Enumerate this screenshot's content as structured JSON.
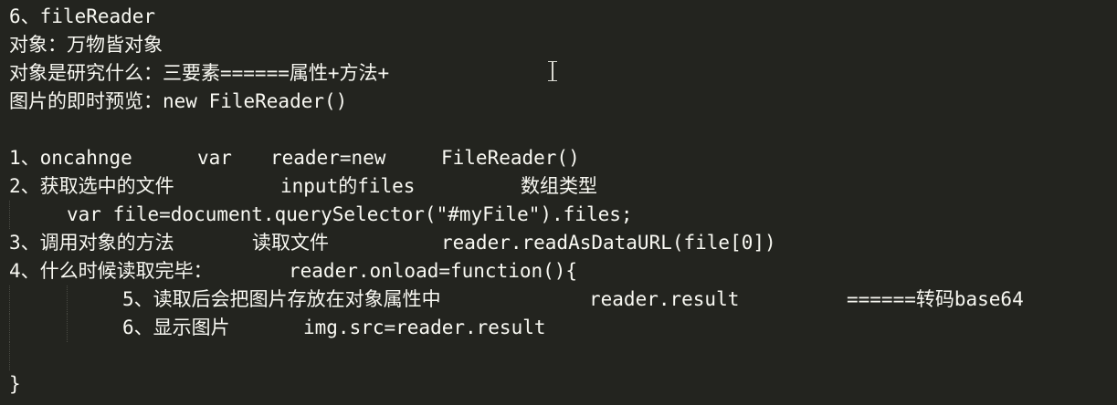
{
  "editor": {
    "lines": {
      "l1": "6、fileReader",
      "l2": "对象：万物皆对象",
      "l3": "对象是研究什么：三要素======属性+方法+",
      "l4": "图片的即时预览：new FileReader()",
      "l5": "",
      "l6a": "1、oncahnge",
      "l6b": "var",
      "l6c": "reader=new",
      "l6d": "FileReader()",
      "l7a": "2、获取选中的文件",
      "l7b": "input的files",
      "l7c": "数组类型",
      "l8": "var file=document.querySelector(\"#myFile\").files;",
      "l9a": "3、调用对象的方法",
      "l9b": "读取文件",
      "l9c": "reader.readAsDataURL(file[0])",
      "l10a": "4、什么时候读取完毕：",
      "l10b": "reader.onload=function(){",
      "l11a": "5、读取后会把图片存放在对象属性中",
      "l11b": "reader.result",
      "l11c": "======转码base64",
      "l12a": "6、显示图片",
      "l12b": "img.src=reader.result",
      "l13": "",
      "l14": "}"
    },
    "colors": {
      "background": "#23241f",
      "text": "#f8f8f2"
    },
    "cursor_icon": "text-cursor-ibeam-icon"
  }
}
